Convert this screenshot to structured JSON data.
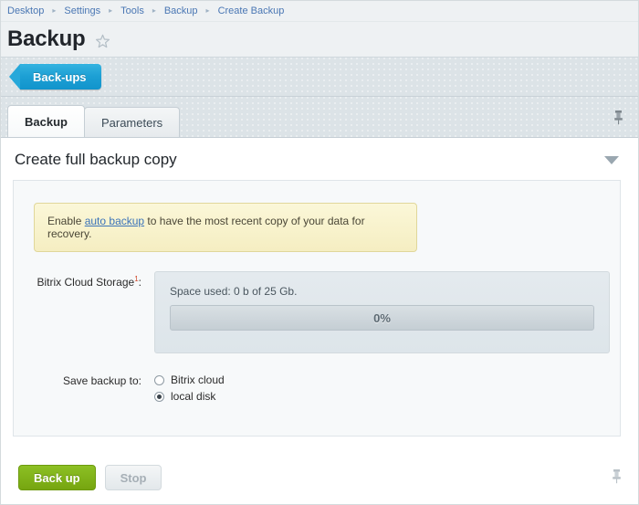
{
  "breadcrumb": {
    "separator": "▸",
    "items": [
      {
        "label": "Desktop"
      },
      {
        "label": "Settings"
      },
      {
        "label": "Tools"
      },
      {
        "label": "Backup"
      },
      {
        "label": "Create Backup"
      }
    ]
  },
  "header": {
    "title": "Backup",
    "star_icon": "star-outline-icon"
  },
  "toolbar": {
    "backups_tab_label": "Back-ups",
    "accent_color": "#1c9fd4"
  },
  "tabs": {
    "items": [
      {
        "label": "Backup",
        "active": true
      },
      {
        "label": "Parameters",
        "active": false
      }
    ],
    "pin_icon": "pushpin-icon"
  },
  "section": {
    "title": "Create full backup copy",
    "collapse_icon": "chevron-down-icon"
  },
  "note": {
    "prefix": "Enable ",
    "link_label": "auto backup",
    "suffix": " to have the most recent copy of your data for recovery.",
    "link_color": "#3b73b9",
    "background_color": "#faf6d6"
  },
  "storage": {
    "label": "Bitrix Cloud Storage",
    "footnote_marker": "1",
    "label_colon": ":",
    "space_used_text": "Space used: 0 b of 25 Gb.",
    "progress_percent_label": "0%",
    "progress_percent_value": 0
  },
  "save_to": {
    "label": "Save backup to:",
    "options": [
      {
        "label": "Bitrix cloud",
        "selected": false
      },
      {
        "label": "local disk",
        "selected": true
      }
    ]
  },
  "footer": {
    "backup_button_label": "Back up",
    "stop_button_label": "Stop",
    "stop_disabled": true,
    "pin_icon": "pushpin-icon",
    "primary_color": "#7ead14"
  }
}
